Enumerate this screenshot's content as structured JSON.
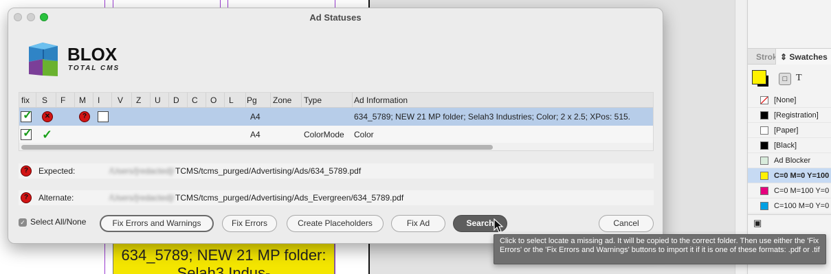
{
  "window": {
    "title": "Ad Statuses"
  },
  "logo": {
    "brand": "BLOX",
    "subtitle": "TOTAL CMS"
  },
  "table": {
    "headers": [
      "fix",
      "S",
      "F",
      "M",
      "I",
      "V",
      "Z",
      "U",
      "D",
      "C",
      "O",
      "L",
      "Pg",
      "Zone",
      "Type",
      "Ad Information"
    ],
    "rows": [
      {
        "pg": "A4",
        "zone": "",
        "type": "",
        "info": "634_5789; NEW 21 MP folder; Selah3 Industries; Color; 2 x 2.5; XPos: 515.",
        "selected": true
      },
      {
        "pg": "A4",
        "zone": "",
        "type": "ColorMode",
        "info": "Color",
        "selected": false
      }
    ]
  },
  "paths": {
    "expected_label": "Expected:",
    "expected_blurred": "/Users/[redacted]/",
    "expected_value": "TCMS/tcms_purged/Advertising/Ads/634_5789.pdf",
    "alternate_label": "Alternate:",
    "alternate_blurred": "/Users/[redacted]/",
    "alternate_value": "TCMS/tcms_purged/Advertising/Ads_Evergreen/634_5789.pdf"
  },
  "controls": {
    "select_all_label": "Select All/None",
    "select_all_checked": true,
    "fix_errors_warnings": "Fix Errors and Warnings",
    "fix_errors": "Fix Errors",
    "create_placeholders": "Create Placeholders",
    "fix_ad": "Fix Ad",
    "search": "Search",
    "cancel": "Cancel"
  },
  "tooltip": {
    "text": "Click to select locate a missing ad. It will be copied to the correct folder. Then use either the 'Fix Errors' or the 'Fix Errors and Warnings' buttons to import it if it is one of these formats: .pdf or .tif"
  },
  "background_doc": {
    "ad_text": "634_5789; NEW 21 MP folder: Selah3 Indus-"
  },
  "swatches_panel": {
    "tab_stroke": "Strok",
    "tab_swatches": "Swatches",
    "tab_swatches_icon": "updown-chevron-icon",
    "swatches": [
      {
        "name": "[None]",
        "color": "none"
      },
      {
        "name": "[Registration]",
        "color": "#000000"
      },
      {
        "name": "[Paper]",
        "color": "#ffffff"
      },
      {
        "name": "[Black]",
        "color": "#000000"
      },
      {
        "name": "Ad Blocker",
        "color": "#d9ecdc"
      },
      {
        "name": "C=0 M=0 Y=100",
        "color": "#fff200",
        "selected": true
      },
      {
        "name": "C=0 M=100 Y=0",
        "color": "#e6007e"
      },
      {
        "name": "C=100 M=0 Y=0",
        "color": "#00a0e3"
      }
    ]
  },
  "colors": {
    "selected_row": "#b7cde9",
    "error_red": "#d21414",
    "check_green": "#1a9a1a",
    "tooltip_bg": "#6f6f6f"
  }
}
